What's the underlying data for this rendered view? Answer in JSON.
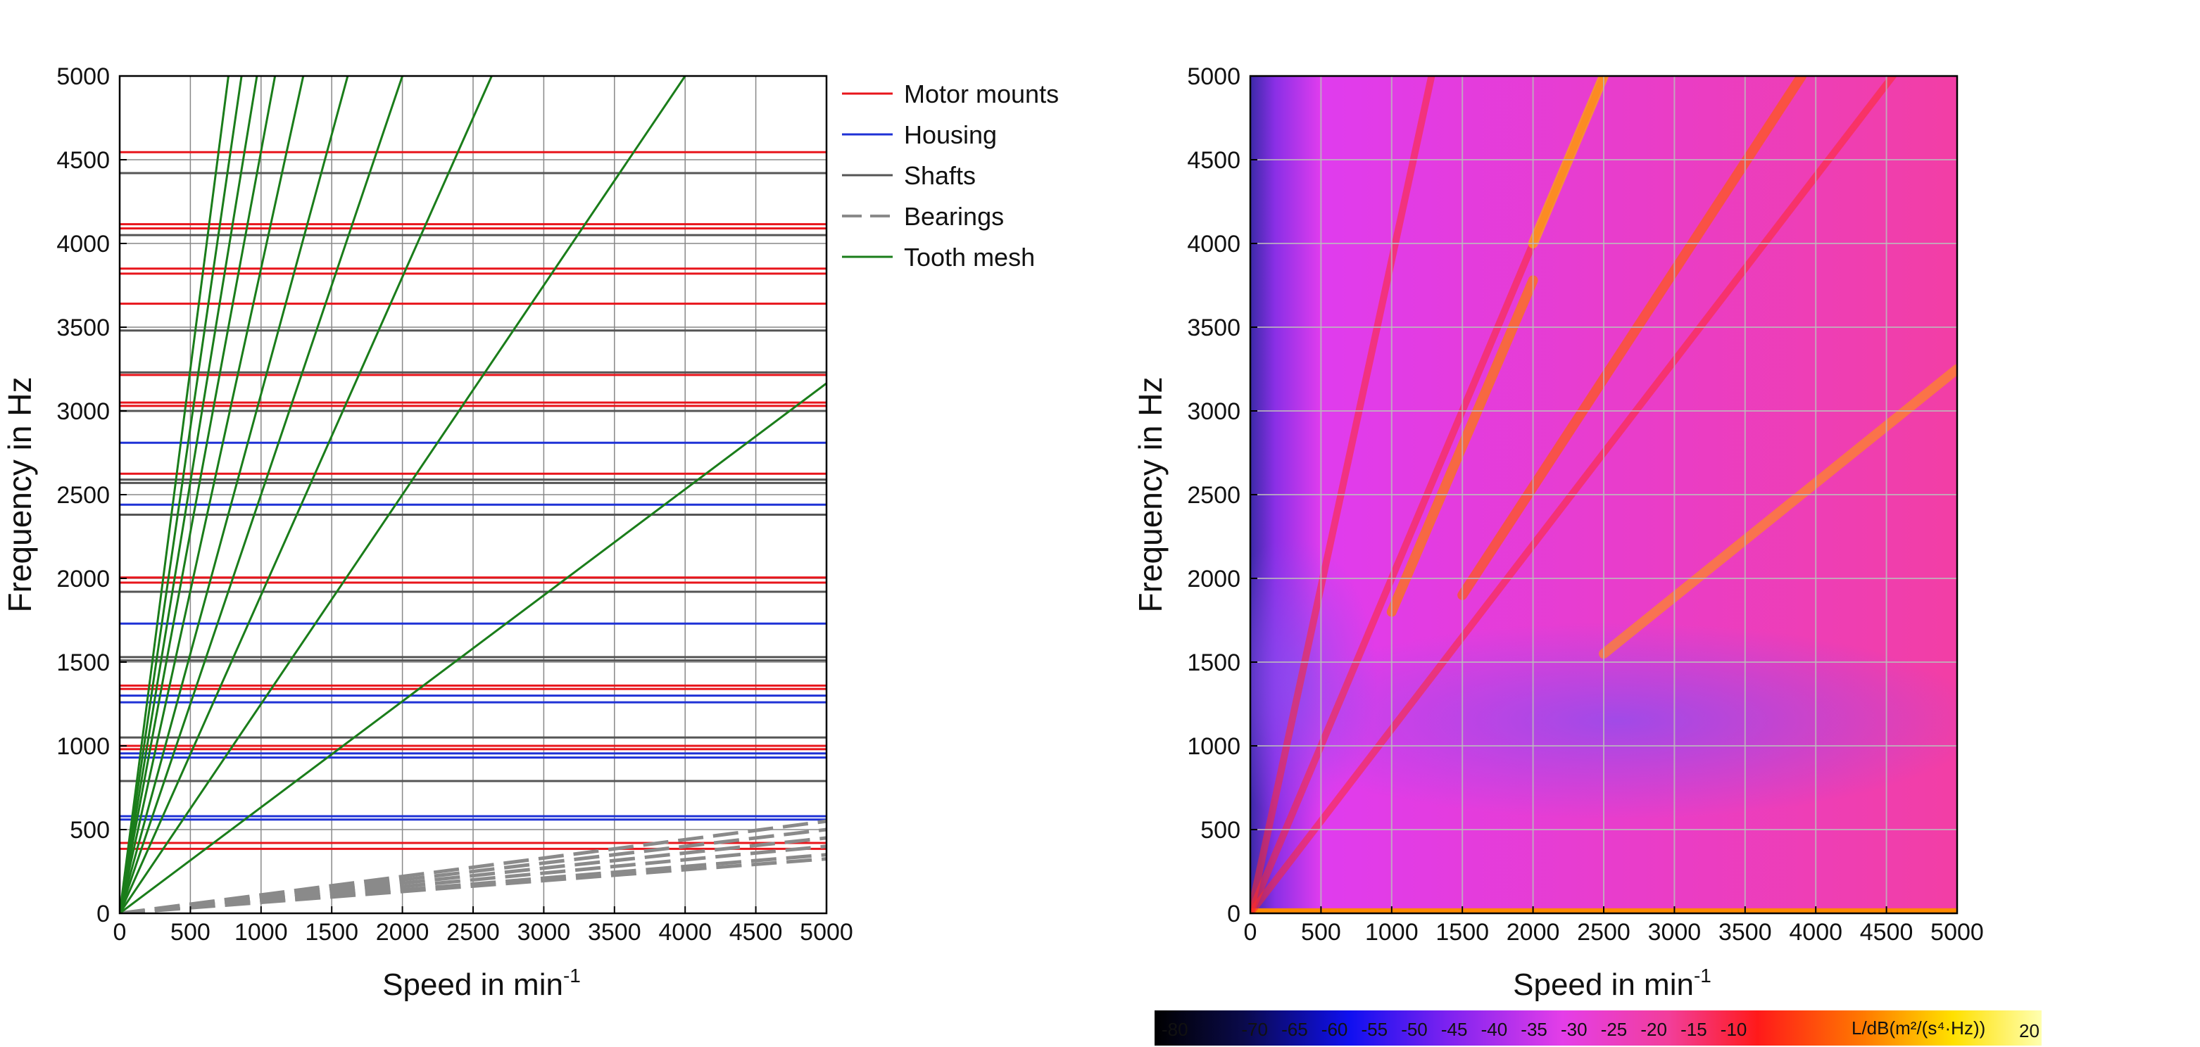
{
  "chart_data": [
    {
      "type": "line",
      "title": "",
      "xlabel": "Speed in min",
      "xlabel_sup": "-1",
      "ylabel": "Frequency in Hz",
      "xlim": [
        0,
        5000
      ],
      "ylim": [
        0,
        5000
      ],
      "x_ticks": [
        0,
        500,
        1000,
        1500,
        2000,
        2500,
        3000,
        3500,
        4000,
        4500,
        5000
      ],
      "y_ticks": [
        0,
        500,
        1000,
        1500,
        2000,
        2500,
        3000,
        3500,
        4000,
        4500,
        5000
      ],
      "grid": true,
      "legend_position": "right of plot, top",
      "series": [
        {
          "name": "Motor mounts",
          "color": "#e8151b",
          "style": "solid",
          "kind": "horizontal",
          "values": [
            385,
            420,
            980,
            1000,
            1340,
            1360,
            1975,
            2005,
            2625,
            3030,
            3050,
            3215,
            3640,
            3820,
            3850,
            4090,
            4115,
            4545
          ]
        },
        {
          "name": "Housing",
          "color": "#1f32d6",
          "style": "solid",
          "kind": "horizontal",
          "values": [
            560,
            580,
            930,
            955,
            1260,
            1300,
            1730,
            2440,
            2810
          ]
        },
        {
          "name": "Shafts",
          "color": "#555555",
          "style": "solid",
          "kind": "horizontal",
          "values": [
            790,
            1050,
            1510,
            1530,
            1920,
            2380,
            2570,
            2590,
            3000,
            3230,
            3480,
            4050,
            4420
          ]
        },
        {
          "name": "Bearings",
          "color": "#8a8a8a",
          "style": "dashed",
          "kind": "order",
          "orders": [
            0.065,
            0.07,
            0.08,
            0.09,
            0.1,
            0.11
          ]
        },
        {
          "name": "Tooth mesh",
          "color": "#1a7d1a",
          "style": "solid",
          "kind": "order",
          "orders": [
            0.633,
            1.25,
            1.9,
            2.5,
            3.1,
            3.85,
            4.55,
            5.15,
            5.8,
            6.5
          ]
        }
      ]
    },
    {
      "type": "heatmap",
      "title": "",
      "xlabel": "Speed in min",
      "xlabel_sup": "-1",
      "ylabel": "Frequency in Hz",
      "xlim": [
        0,
        5000
      ],
      "ylim": [
        0,
        5000
      ],
      "x_ticks": [
        0,
        500,
        1000,
        1500,
        2000,
        2500,
        3000,
        3500,
        4000,
        4500,
        5000
      ],
      "y_ticks": [
        0,
        500,
        1000,
        1500,
        2000,
        2500,
        3000,
        3500,
        4000,
        4500,
        5000
      ],
      "grid": true,
      "colorbar": {
        "label": "L/dB(m²/(s⁴·Hz))",
        "ticks": [
          -80,
          -70,
          -65,
          -60,
          -55,
          -50,
          -45,
          -40,
          -35,
          -30,
          -25,
          -20,
          -15,
          -10,
          20
        ],
        "range": [
          -80,
          20
        ],
        "position": "bottom"
      }
    }
  ]
}
